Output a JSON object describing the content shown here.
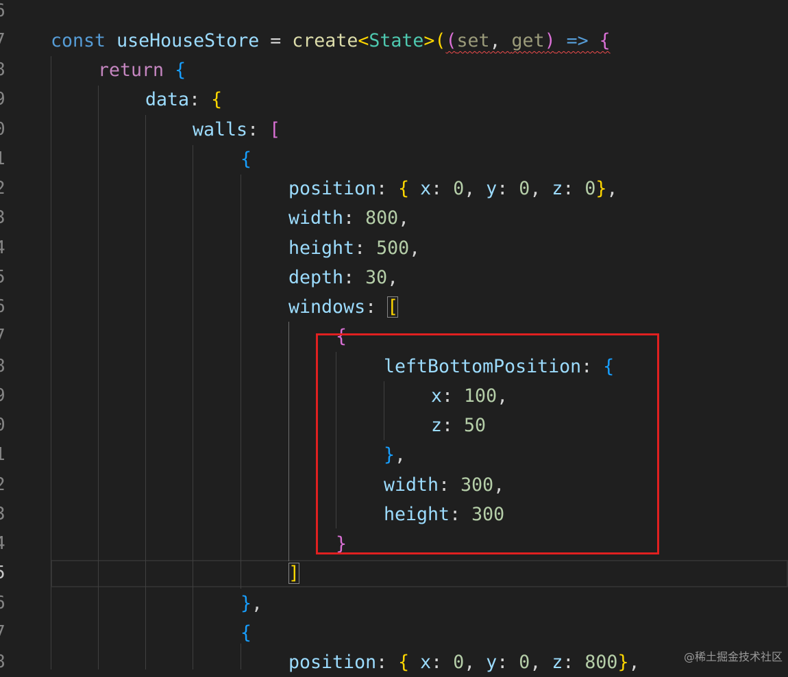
{
  "editor": {
    "line_numbers": [
      "6",
      "7",
      "8",
      "9",
      "0",
      "1",
      "2",
      "3",
      "4",
      "5",
      "6",
      "7",
      "8",
      "9",
      "0",
      "1",
      "2",
      "3",
      "4",
      "5",
      "6",
      "7",
      "8"
    ],
    "active_line_number": "5",
    "code": {
      "l7": {
        "const": "const",
        "name": "useHouseStore",
        "eq": " = ",
        "create": "create",
        "lt": "<",
        "type": "State",
        "gt": ">",
        "p1": "(",
        "p2": "(",
        "set": "set",
        "comma": ", ",
        "get": "get",
        "p3": ")",
        "arrow": " => ",
        "brace": "{"
      },
      "l8": {
        "return": "return",
        "brace": " {"
      },
      "l9": {
        "key": "data",
        "colon": ": ",
        "brace": "{"
      },
      "l10": {
        "key": "walls",
        "colon": ": ",
        "bracket": "["
      },
      "l11": {
        "brace": "{"
      },
      "l12": {
        "key": "position",
        "colon": ": ",
        "ob": "{",
        "x": " x",
        "c1": ": ",
        "v1": "0",
        "sep1": ", ",
        "y": "y",
        "c2": ": ",
        "v2": "0",
        "sep2": ", ",
        "z": "z",
        "c3": ": ",
        "v3": "0",
        "cb": "}",
        "end": ","
      },
      "l13": {
        "key": "width",
        "colon": ": ",
        "val": "800",
        "end": ","
      },
      "l14": {
        "key": "height",
        "colon": ": ",
        "val": "500",
        "end": ","
      },
      "l15": {
        "key": "depth",
        "colon": ": ",
        "val": "30",
        "end": ","
      },
      "l16": {
        "key": "windows",
        "colon": ": ",
        "bracket": "["
      },
      "l17": {
        "brace": "{"
      },
      "l18": {
        "key": "leftBottomPosition",
        "colon": ": ",
        "brace": "{"
      },
      "l19": {
        "key": "x",
        "colon": ": ",
        "val": "100",
        "end": ","
      },
      "l20": {
        "key": "z",
        "colon": ": ",
        "val": "50"
      },
      "l21": {
        "brace": "}",
        "end": ","
      },
      "l22": {
        "key": "width",
        "colon": ": ",
        "val": "300",
        "end": ","
      },
      "l23": {
        "key": "height",
        "colon": ": ",
        "val": "300"
      },
      "l24": {
        "brace": "}"
      },
      "l25": {
        "bracket": "]"
      },
      "l26": {
        "brace": "}",
        "end": ","
      },
      "l27": {
        "brace": "{"
      },
      "l28": {
        "key": "position",
        "colon": ": ",
        "ob": "{",
        "x": " x",
        "c1": ": ",
        "v1": "0",
        "sep1": ", ",
        "y": "y",
        "c2": ": ",
        "v2": "0",
        "sep2": ", ",
        "z": "z",
        "c3": ": ",
        "v3": "800",
        "cb": "}",
        "end": ","
      }
    }
  },
  "watermark": "@稀土掘金技术社区",
  "colors": {
    "highlight_box": "#e02020",
    "background": "#1f1f1f"
  }
}
